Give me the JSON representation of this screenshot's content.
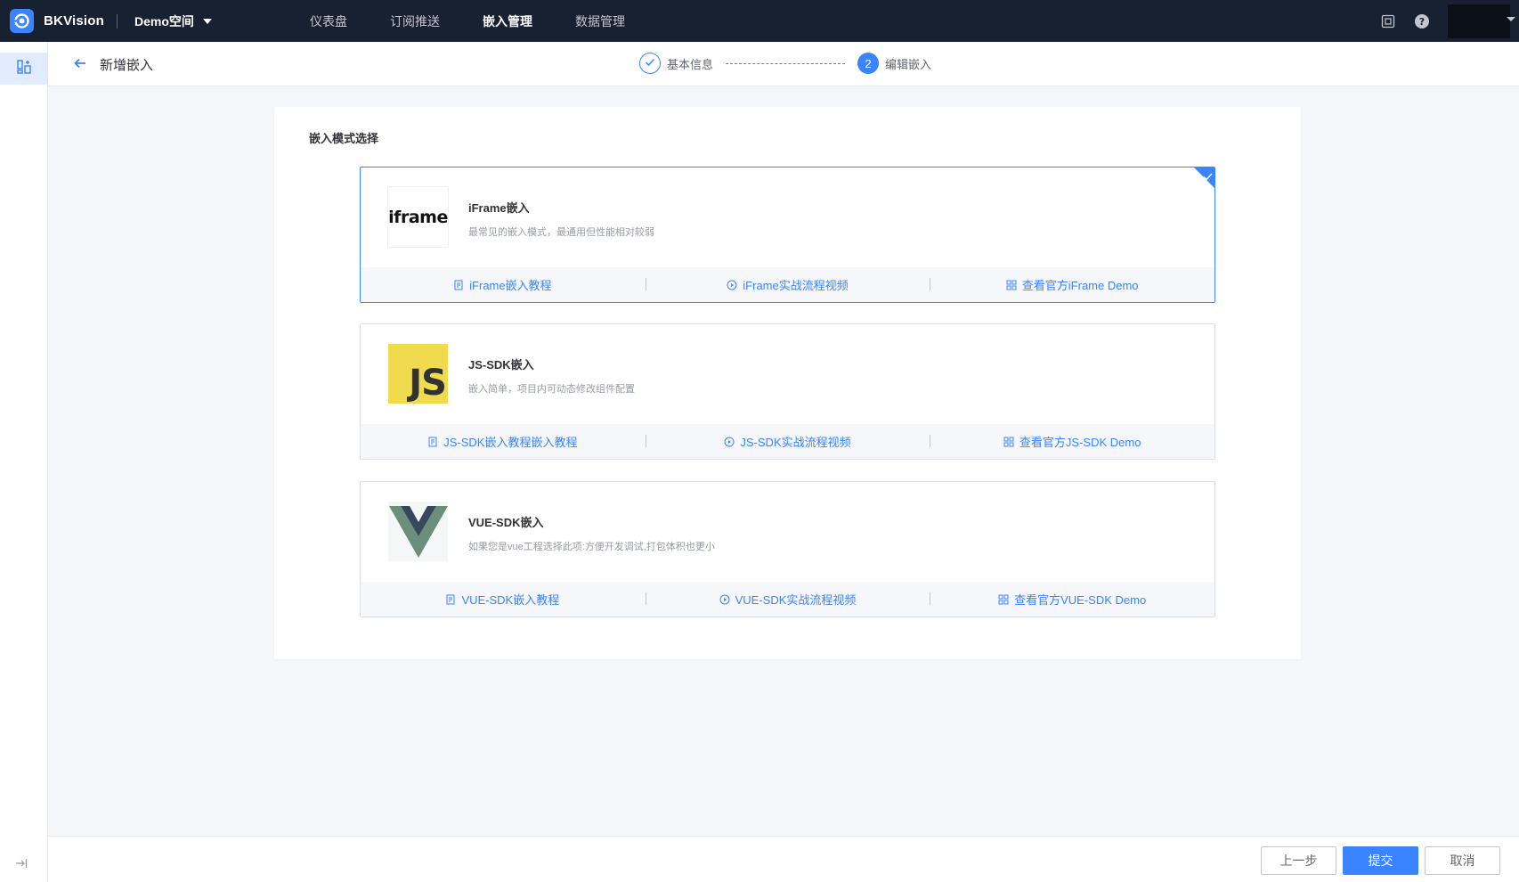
{
  "topbar": {
    "brand": "BKVision",
    "space": "Demo空间",
    "nav": [
      {
        "label": "仪表盘",
        "active": false
      },
      {
        "label": "订阅推送",
        "active": false
      },
      {
        "label": "嵌入管理",
        "active": true
      },
      {
        "label": "数据管理",
        "active": false
      }
    ]
  },
  "header": {
    "title": "新增嵌入",
    "steps": [
      {
        "label": "基本信息",
        "status": "done"
      },
      {
        "number": "2",
        "label": "编辑嵌入",
        "status": "current"
      }
    ]
  },
  "main": {
    "section_title": "嵌入模式选择",
    "cards": [
      {
        "logo_text": "iframe",
        "name": "iFrame嵌入",
        "desc": "最常见的嵌入模式，最通用但性能相对较弱",
        "selected": true,
        "links": [
          "iFrame嵌入教程",
          "iFrame实战流程视频",
          "查看官方iFrame Demo"
        ]
      },
      {
        "logo_text": "JS",
        "name": "JS-SDK嵌入",
        "desc": "嵌入简单，项目内可动态修改组件配置",
        "selected": false,
        "links": [
          "JS-SDK嵌入教程嵌入教程",
          "JS-SDK实战流程视频",
          "查看官方JS-SDK Demo"
        ]
      },
      {
        "logo_text": "",
        "name": "VUE-SDK嵌入",
        "desc": "如果您是vue工程选择此项:方便开发调试,打包体积也更小",
        "selected": false,
        "links": [
          "VUE-SDK嵌入教程",
          "VUE-SDK实战流程视频",
          "查看官方VUE-SDK Demo"
        ]
      }
    ]
  },
  "footer": {
    "prev_label": "上一步",
    "submit_label": "提交",
    "cancel_label": "取消"
  },
  "colors": {
    "primary": "#3a84ff",
    "topbar_bg": "#182132",
    "js_yellow": "#f0db4f",
    "vue_green": "#41b883",
    "vue_dark": "#35495e"
  },
  "icons": [
    "logo-icon",
    "fullscreen-icon",
    "help-icon",
    "dashboard-icon",
    "collapse-icon",
    "back-arrow-icon",
    "check-icon",
    "doc-icon",
    "play-icon",
    "grid-icon"
  ]
}
